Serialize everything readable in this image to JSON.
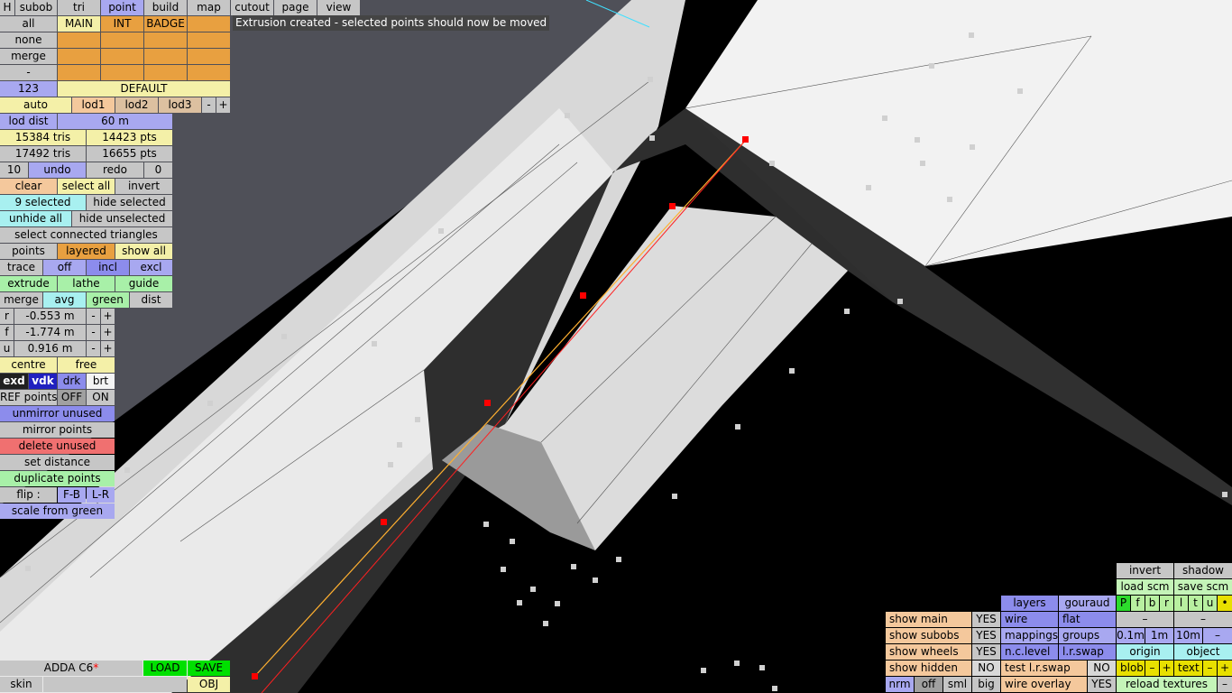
{
  "status_message": "Extrusion created - selected points should now be moved",
  "menu": {
    "h": "H",
    "subob": "subob",
    "tri": "tri",
    "point": "point",
    "build": "build",
    "map": "map",
    "cutout": "cutout",
    "page": "page",
    "view": "view"
  },
  "groups": {
    "all": "all",
    "none": "none",
    "merge": "merge",
    "dash": "-",
    "main": "MAIN",
    "int": "INT",
    "badge": "BADGE"
  },
  "lod": {
    "num": "123",
    "default": "DEFAULT",
    "auto": "auto",
    "lod1": "lod1",
    "lod2": "lod2",
    "lod3": "lod3",
    "minus": "-",
    "plus": "+",
    "dist_label": "lod dist",
    "dist_value": "60 m"
  },
  "stats": {
    "tris1": "15384 tris",
    "pts1": "14423 pts",
    "tris2": "17492 tris",
    "pts2": "16655 pts",
    "undo_count": "10",
    "undo": "undo",
    "redo": "redo",
    "redo_count": "0"
  },
  "selection": {
    "clear": "clear",
    "select_all": "select all",
    "invert": "invert",
    "selected": "9 selected",
    "hide_selected": "hide selected",
    "unhide_all": "unhide all",
    "hide_unselected": "hide unselected",
    "select_connected": "select connected triangles"
  },
  "points": {
    "points": "points",
    "layered": "layered",
    "show_all": "show all",
    "trace": "trace",
    "off": "off",
    "incl": "incl",
    "excl": "excl",
    "extrude": "extrude",
    "lathe": "lathe",
    "guide": "guide",
    "merge": "merge",
    "avg": "avg",
    "green": "green",
    "dist": "dist"
  },
  "coords": {
    "r_label": "r",
    "r_value": "-0.553 m",
    "f_label": "f",
    "f_value": "-1.774 m",
    "u_label": "u",
    "u_value": "0.916 m",
    "minus": "-",
    "plus": "+"
  },
  "tools": {
    "centre": "centre",
    "free": "free",
    "exd": "exd",
    "vdk": "vdk",
    "drk": "drk",
    "brt": "brt",
    "ref_points": "REF points",
    "off": "OFF",
    "on": "ON",
    "unmirror": "unmirror unused",
    "mirror": "mirror points",
    "delete_unused": "delete unused",
    "set_distance": "set distance",
    "duplicate": "duplicate points",
    "flip": "flip :",
    "fb": "F-B",
    "lr": "L-R",
    "scale_green": "scale from green"
  },
  "file": {
    "name": "ADDA C6",
    "modified": "*",
    "load": "LOAD",
    "save": "SAVE",
    "skin": "skin",
    "obj": "OBJ"
  },
  "view_panel": {
    "invert": "invert",
    "shadow": "shadow",
    "load_scm": "load scm",
    "save_scm": "save scm",
    "layers": "layers",
    "gouraud": "gouraud",
    "pfbrltu": [
      "P",
      "f",
      "b",
      "r",
      "l",
      "t",
      "u"
    ],
    "dot": "•",
    "show_main": "show main",
    "yes": "YES",
    "no": "NO",
    "wire": "wire",
    "flat": "flat",
    "dash": "–",
    "show_subobs": "show subobs",
    "mappings": "mappings",
    "groups": "groups",
    "s01": "0.1m",
    "s1": "1m",
    "s10": "10m",
    "minus": "–",
    "show_wheels": "show wheels",
    "nclevel": "n.c.level",
    "lrswap": "l.r.swap",
    "origin": "origin",
    "object": "object",
    "show_hidden": "show hidden",
    "test_lrswap": "test l.r.swap",
    "blob": "blob",
    "plus": "+",
    "text": "text",
    "nrm": "nrm",
    "off": "off",
    "sml": "sml",
    "big": "big",
    "wire_overlay": "wire overlay",
    "reload_textures": "reload textures"
  },
  "colors": {
    "canvas_black": "#000000",
    "canvas_gray": "#505058",
    "mesh_white": "#e6e6e6",
    "mesh_dark": "#303030",
    "selection_red": "#ff0000",
    "edge_orange": "#ffb030"
  }
}
